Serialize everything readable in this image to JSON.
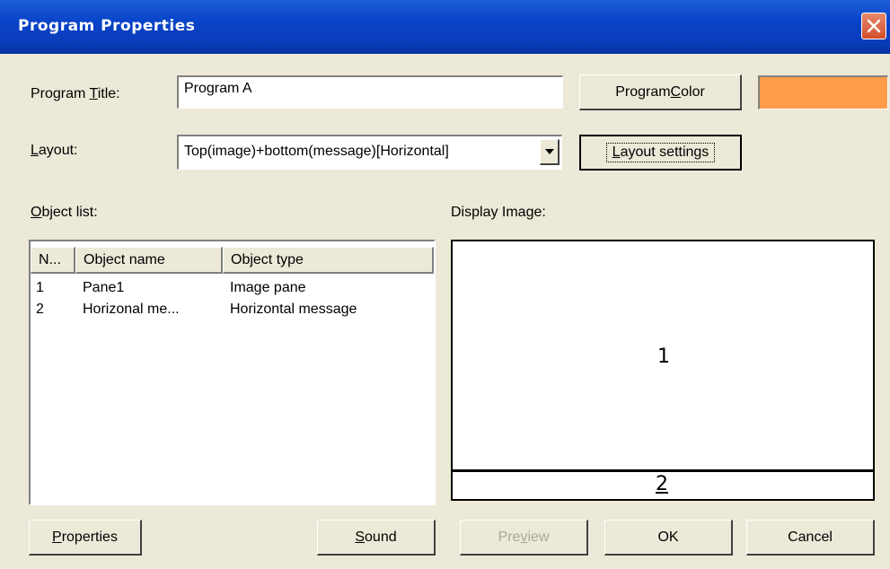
{
  "window": {
    "title": "Program Properties"
  },
  "program_title": {
    "label_pre": "Program ",
    "label_accel": "T",
    "label_post": "itle:",
    "value": "Program A"
  },
  "program_color": {
    "button_pre": "Program ",
    "button_accel": "C",
    "button_post": "olor",
    "swatch_color": "#ff9c4a"
  },
  "layout": {
    "label_accel": "L",
    "label_post": "ayout:",
    "selected": "Top(image)+bottom(message)[Horizontal]",
    "settings_accel": "L",
    "settings_post": "ayout settings"
  },
  "object_list": {
    "label_accel": "O",
    "label_post": "bject list:",
    "columns": [
      "N...",
      "Object name",
      "Object type"
    ],
    "rows": [
      {
        "num": "1",
        "name": "Pane1",
        "type": "Image pane"
      },
      {
        "num": "2",
        "name": "Horizonal me...",
        "type": "Horizontal message"
      }
    ]
  },
  "display_image": {
    "label": "Display Image:",
    "panes": [
      "1",
      "2"
    ]
  },
  "buttons": {
    "properties_accel": "P",
    "properties_post": "roperties",
    "sound_accel": "S",
    "sound_post": "ound",
    "preview_pre": "Pre",
    "preview_accel": "v",
    "preview_post": "iew",
    "ok": "OK",
    "cancel": "Cancel"
  }
}
